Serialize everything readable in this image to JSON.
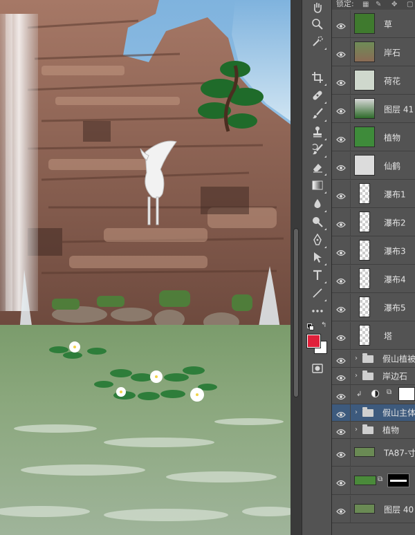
{
  "panel": {
    "lock_label": "锁定:",
    "lock_icons": [
      "lock-transparent-icon",
      "lock-image-icon",
      "lock-position-icon",
      "lock-all-icon"
    ]
  },
  "tools": [
    "hand-icon",
    "zoom-icon",
    "quick-select-icon",
    "crop-icon",
    "healing-brush-icon",
    "brush-icon",
    "clone-stamp-icon",
    "history-brush-icon",
    "eraser-icon",
    "gradient-icon",
    "blur-icon",
    "dodge-icon",
    "pen-icon",
    "path-select-icon",
    "type-icon",
    "line-icon",
    "more-tools-icon",
    "default-colors-icon",
    "swap-colors-icon",
    "quick-mask-icon"
  ],
  "colors": {
    "foreground": "#e0203a",
    "background": "#ffffff",
    "selection": "#3d5a7d",
    "panel": "#535353"
  },
  "layers": [
    {
      "name": "草",
      "kind": "pixel"
    },
    {
      "name": "岸石",
      "kind": "pixel"
    },
    {
      "name": "荷花",
      "kind": "pixel"
    },
    {
      "name": "图层 41",
      "kind": "pixel"
    },
    {
      "name": "植物",
      "kind": "pixel"
    },
    {
      "name": "仙鹤",
      "kind": "pixel"
    },
    {
      "name": "瀑布1",
      "kind": "pixel"
    },
    {
      "name": "瀑布2",
      "kind": "pixel"
    },
    {
      "name": "瀑布3",
      "kind": "pixel"
    },
    {
      "name": "瀑布4",
      "kind": "pixel"
    },
    {
      "name": "瀑布5",
      "kind": "pixel"
    },
    {
      "name": "塔",
      "kind": "pixel"
    },
    {
      "name": "假山植被",
      "kind": "group"
    },
    {
      "name": "岸边石",
      "kind": "group"
    },
    {
      "name": "",
      "kind": "adjustment"
    },
    {
      "name": "假山主体",
      "kind": "group",
      "selected": true
    },
    {
      "name": "植物",
      "kind": "group"
    },
    {
      "name": "TA87-寸",
      "kind": "pixel"
    },
    {
      "name": "",
      "kind": "masked"
    },
    {
      "name": "图层 40",
      "kind": "pixel"
    }
  ]
}
